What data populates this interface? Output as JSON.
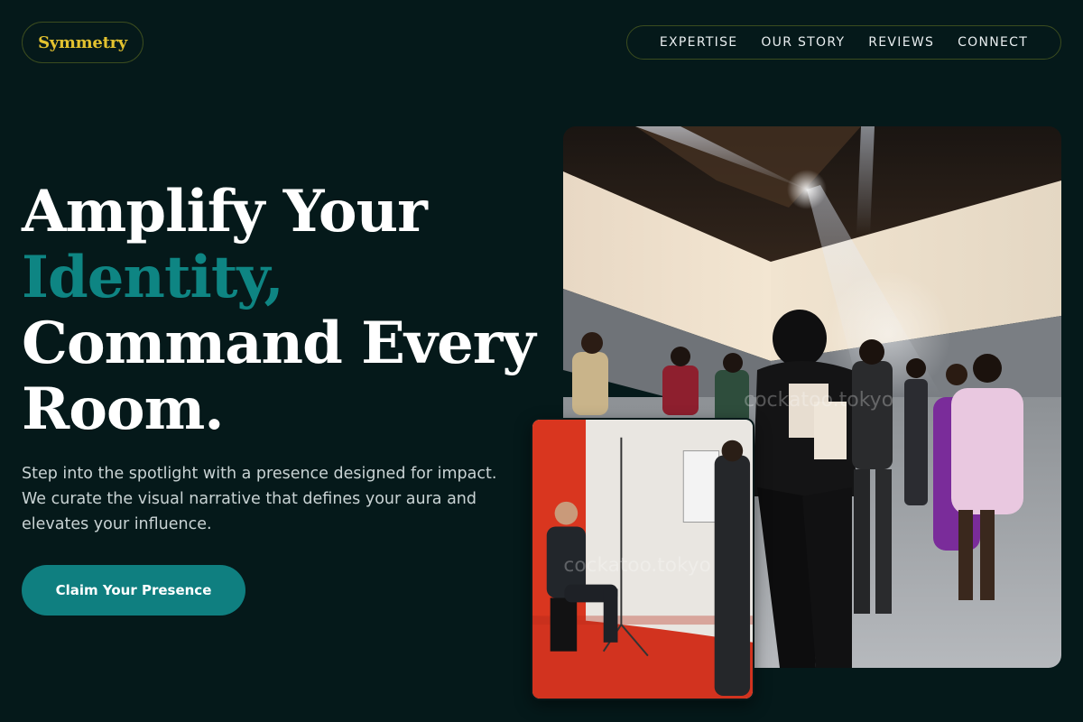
{
  "brand": {
    "name": "Symmetry",
    "color": "#e3c22f"
  },
  "nav": {
    "items": [
      {
        "label": "EXPERTISE"
      },
      {
        "label": "OUR STORY"
      },
      {
        "label": "REVIEWS"
      },
      {
        "label": "CONNECT"
      }
    ]
  },
  "hero": {
    "headline_line1": "Amplify Your",
    "headline_accent": "Identity,",
    "headline_line3": "Command Every",
    "headline_line4": "Room.",
    "subtext": "Step into the spotlight with a presence designed for impact. We curate the visual narrative that defines your aura and elevates your influence.",
    "cta_label": "Claim Your Presence"
  },
  "images": {
    "main_watermark": "cockatoo.tokyo",
    "secondary_watermark": "cockatoo.tokyo"
  },
  "colors": {
    "background": "#05191a",
    "accent_teal": "#0e8583",
    "button": "#0f7f80",
    "outline": "#3b4c1f"
  }
}
